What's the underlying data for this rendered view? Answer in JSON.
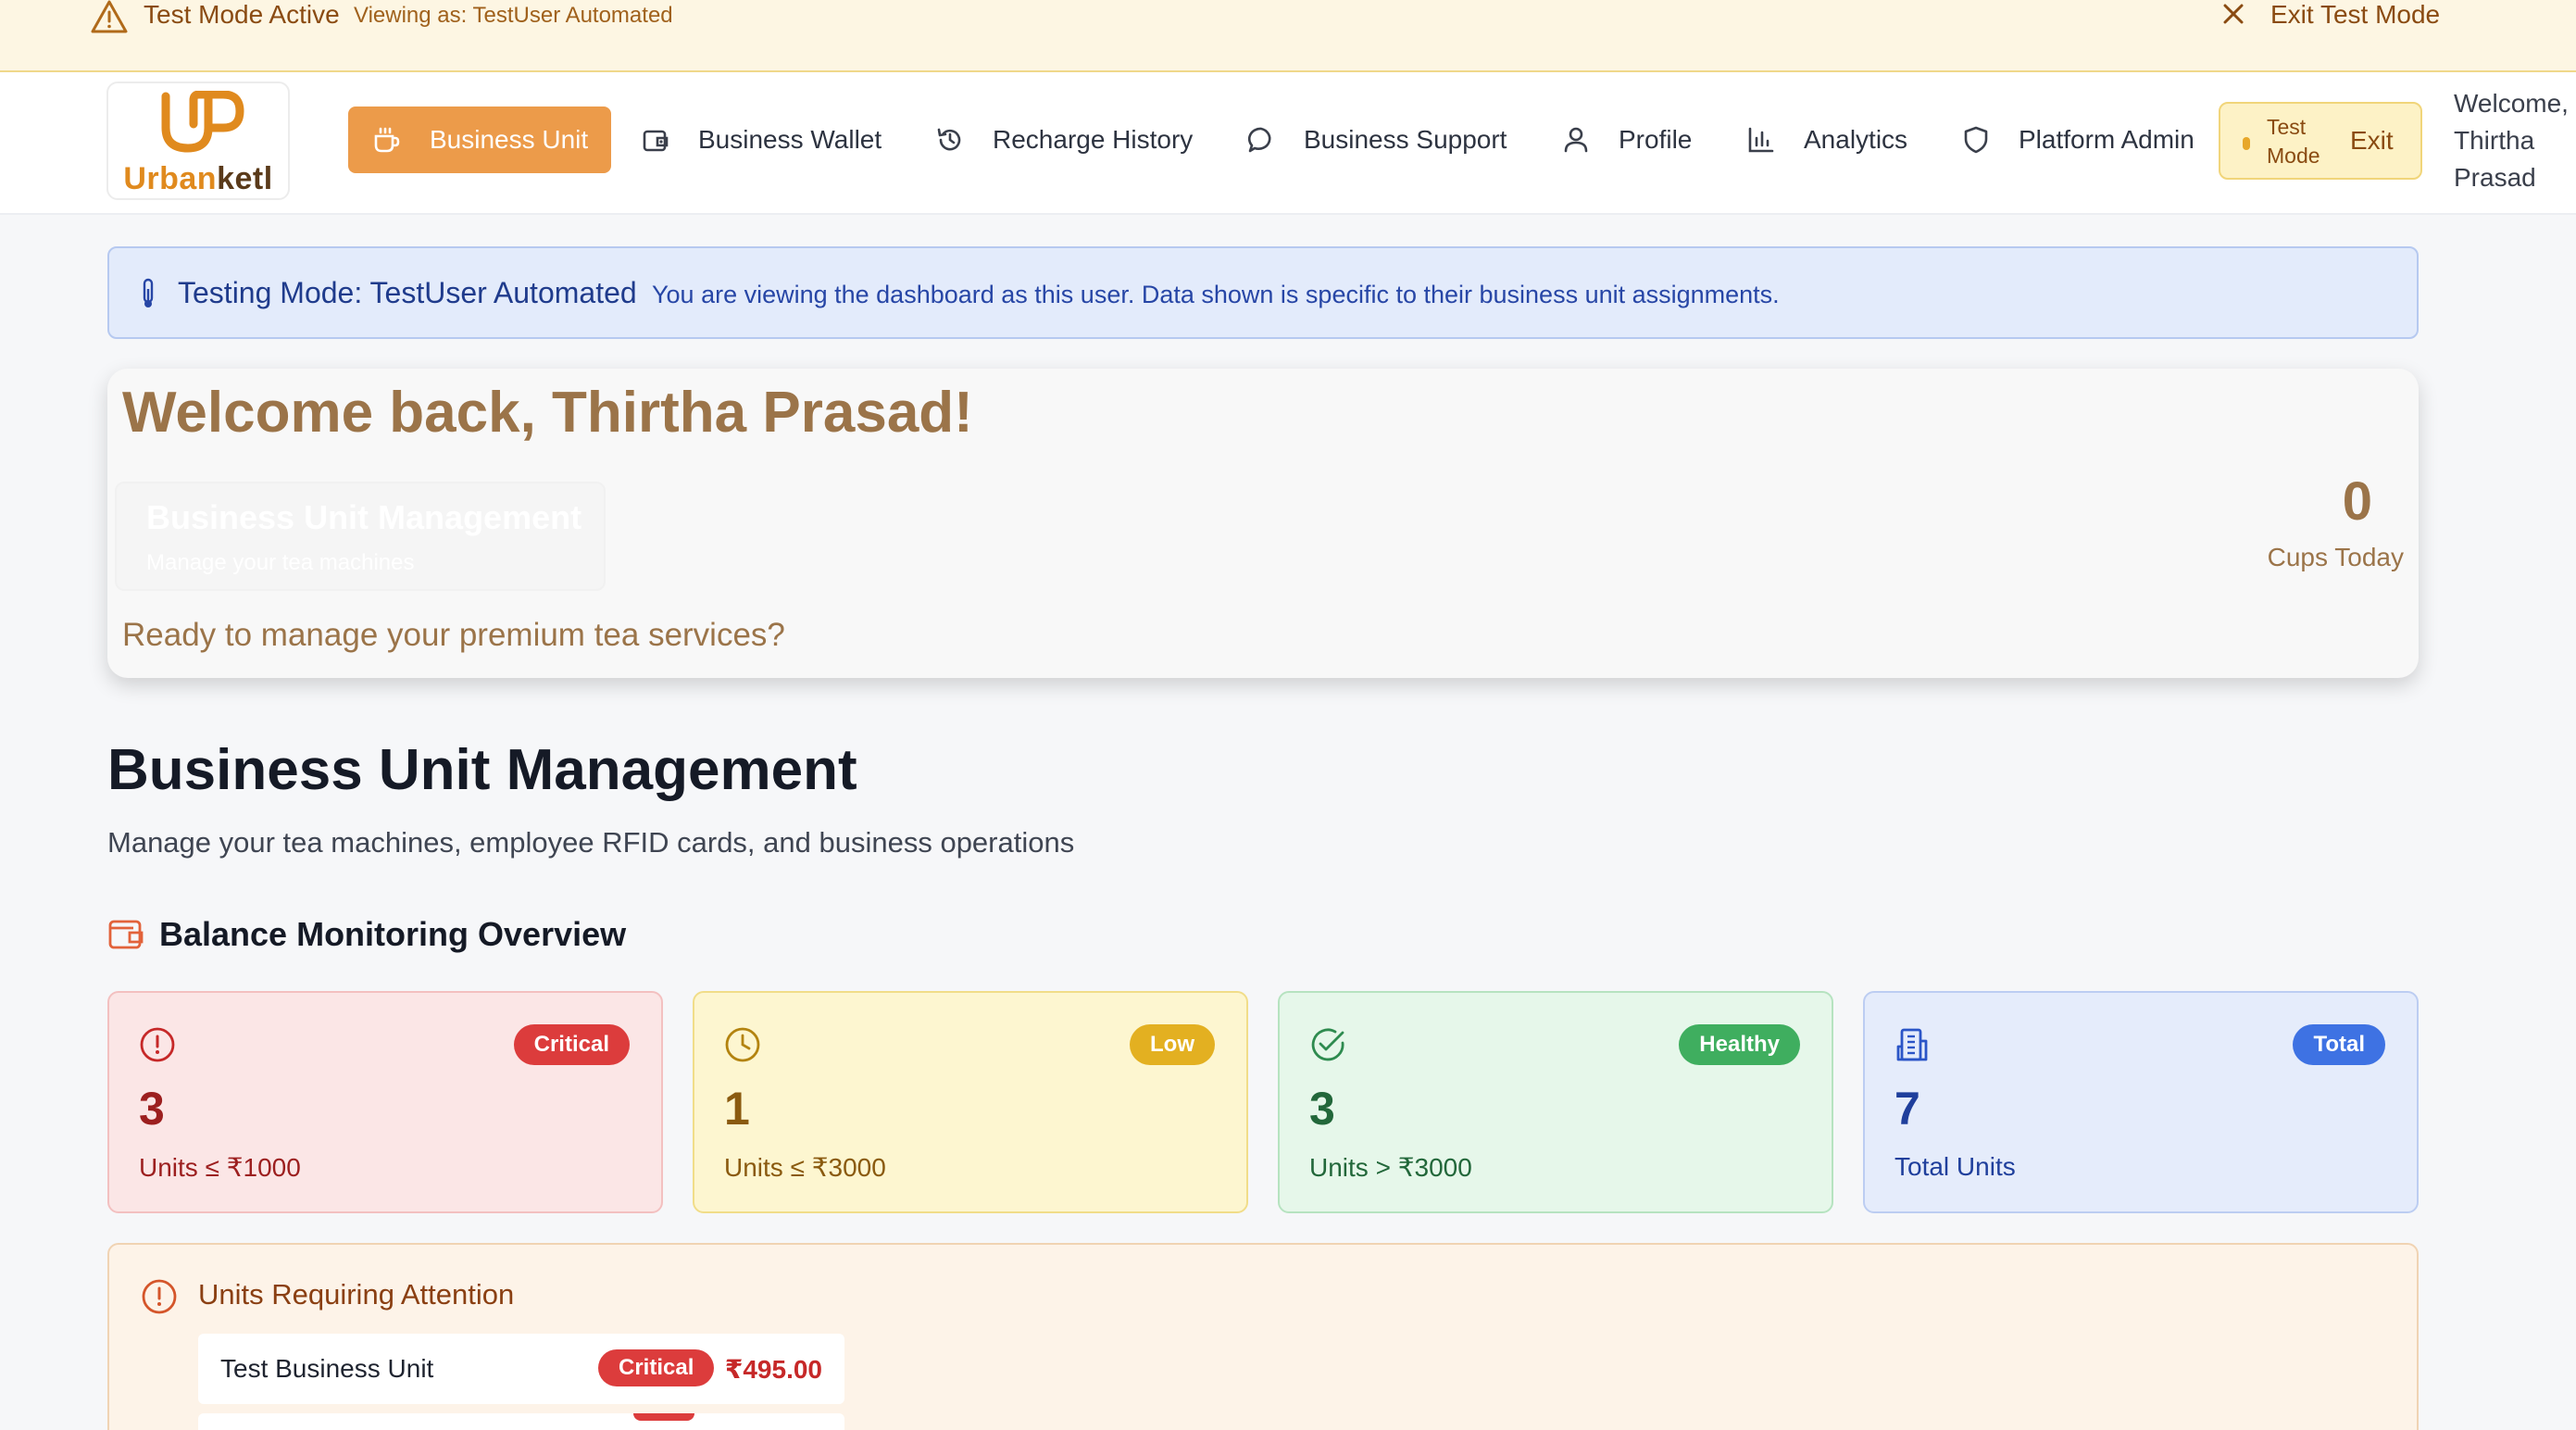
{
  "test_banner": {
    "title": "Test Mode Active",
    "viewing": "Viewing as: TestUser Automated",
    "exit_label": "Exit Test Mode",
    "icons": {
      "warning": "warning-triangle-icon",
      "close": "close-icon"
    }
  },
  "navbar": {
    "logo_text_primary": "Urban",
    "logo_text_secondary": "ketl",
    "items": [
      {
        "label": "Business Unit",
        "icon": "cup-icon",
        "active": true
      },
      {
        "label": "Business Wallet",
        "icon": "wallet-icon",
        "active": false
      },
      {
        "label": "Recharge History",
        "icon": "history-icon",
        "active": false
      },
      {
        "label": "Business Support",
        "icon": "chat-bubble-icon",
        "active": false
      },
      {
        "label": "Profile",
        "icon": "user-icon",
        "active": false
      },
      {
        "label": "Analytics",
        "icon": "bar-chart-icon",
        "active": false
      },
      {
        "label": "Platform Admin",
        "icon": "shield-icon",
        "active": false
      }
    ],
    "test_pill": {
      "label": "Test Mode",
      "exit": "Exit"
    },
    "welcome": "Welcome, Thirtha Prasad"
  },
  "testing_info": {
    "title": "Testing Mode: TestUser Automated",
    "text": "You are viewing the dashboard as this user. Data shown is specific to their business unit assignments."
  },
  "welcome_card": {
    "title": "Welcome back, Thirtha Prasad!",
    "ghost_title": "Business Unit Management",
    "ghost_sub": "Manage your tea machines",
    "subtitle": "Ready to manage your premium tea services?",
    "cups_value": "0",
    "cups_label": "Cups Today"
  },
  "management": {
    "title": "Business Unit Management",
    "subtitle": "Manage your tea machines, employee RFID cards, and business operations",
    "balance_title": "Balance Monitoring Overview"
  },
  "stats": [
    {
      "badge": "Critical",
      "value": "3",
      "label": "Units ≤ ₹1000",
      "icon": "alert-circle-icon",
      "color": "#dc3c3c"
    },
    {
      "badge": "Low",
      "value": "1",
      "label": "Units ≤ ₹3000",
      "icon": "clock-icon",
      "color": "#e3b021"
    },
    {
      "badge": "Healthy",
      "value": "3",
      "label": "Units > ₹3000",
      "icon": "check-circle-icon",
      "color": "#3fae5f"
    },
    {
      "badge": "Total",
      "value": "7",
      "label": "Total Units",
      "icon": "building-icon",
      "color": "#3e72e3"
    }
  ],
  "attention": {
    "title": "Units Requiring Attention",
    "rows": [
      {
        "name": "Test Business Unit",
        "status": "Critical",
        "amount": "₹495.00"
      }
    ]
  },
  "colors": {
    "accent": "#ec9b4a",
    "brand_brown": "#9b7449",
    "critical": "#dc3c3c",
    "info_blue": "#1f3b8c"
  }
}
